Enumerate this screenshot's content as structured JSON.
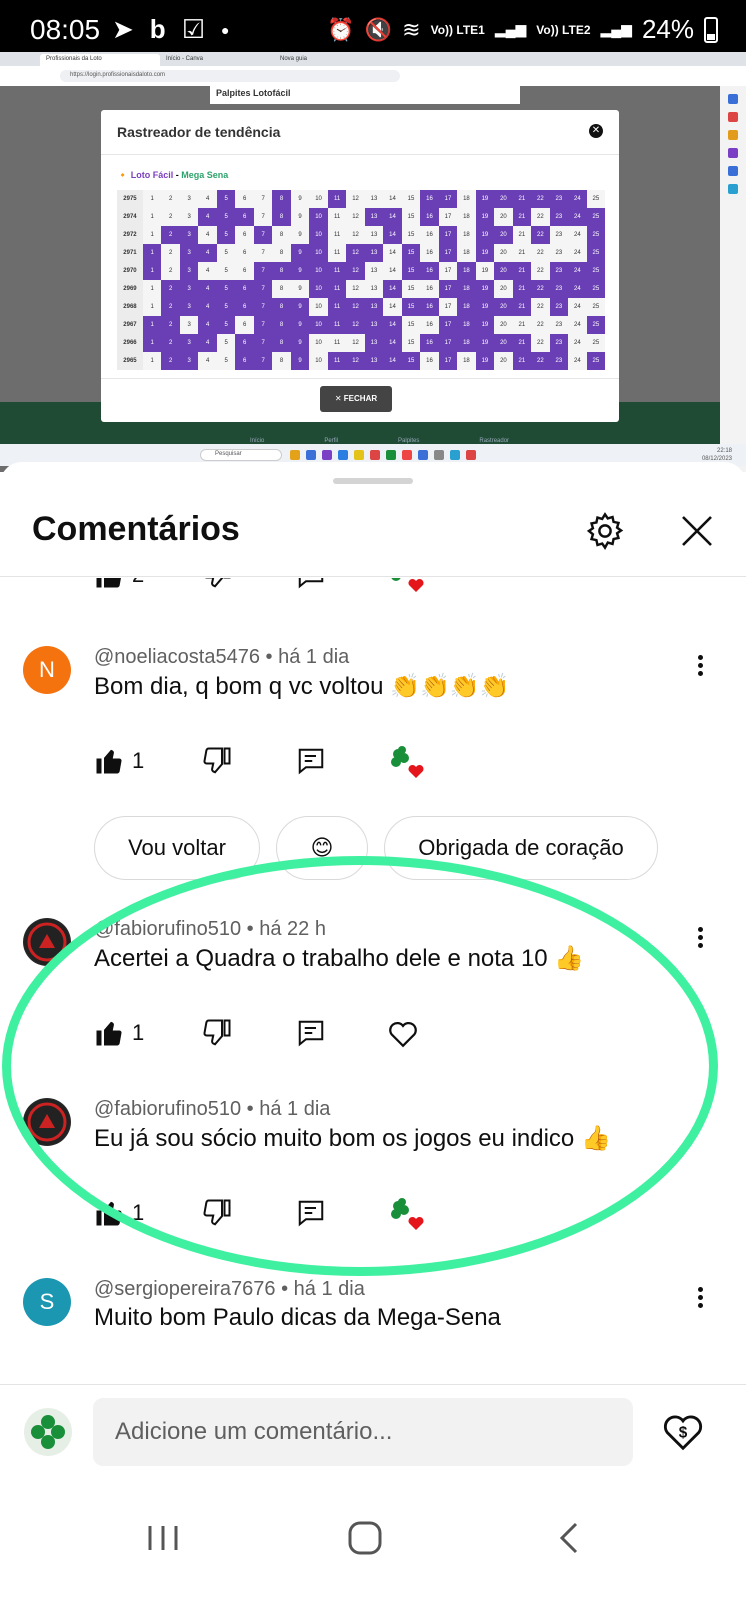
{
  "status_bar": {
    "time": "08:05",
    "battery_percent": "24%",
    "net1": "Vo)) LTE1",
    "net2": "Vo)) LTE2",
    "app_icons": [
      "telegram-icon",
      "b-icon",
      "checkbox-icon",
      "dot-icon"
    ]
  },
  "video": {
    "browser_tabs": [
      "Profissionais da Loto",
      "Início - Canva",
      "Nova guia"
    ],
    "url": "https://login.profissionaisdaloto.com",
    "page_heading": "Palpites Lotofácil",
    "modal": {
      "title": "Rastreador de tendência",
      "lotofacil_label": "Loto Fácil",
      "separator": "-",
      "megasena_label": "Mega Sena",
      "close_button": "FECHAR",
      "numbers": [
        "1",
        "2",
        "3",
        "4",
        "5",
        "6",
        "7",
        "8",
        "9",
        "10",
        "11",
        "12",
        "13",
        "14",
        "15",
        "16",
        "17",
        "18",
        "19",
        "20",
        "21",
        "22",
        "23",
        "24",
        "25"
      ],
      "rows": [
        {
          "contest": "2975",
          "marks": "0000100100100001101111110"
        },
        {
          "contest": "2974",
          "marks": "0001110101001101001010111"
        },
        {
          "contest": "2972",
          "marks": "0110101001000100101101001"
        },
        {
          "contest": "2971",
          "marks": "1011000011011010101000001"
        },
        {
          "contest": "2970",
          "marks": "1010001111110011010110111"
        },
        {
          "contest": "2969",
          "marks": "0111111001100100111011111"
        },
        {
          "contest": "2968",
          "marks": "0111111110111011011110100"
        },
        {
          "contest": "2967",
          "marks": "1101101111111100111000001"
        },
        {
          "contest": "2966",
          "marks": "1111011110001101111110100"
        },
        {
          "contest": "2965",
          "marks": "0110011010111110101011101"
        }
      ]
    },
    "bottom_nav": [
      "Início",
      "Perfil",
      "Palpites",
      "Rastreador"
    ],
    "taskbar_search": "Pesquisar",
    "taskbar_time": "22:18",
    "taskbar_date": "08/12/2023"
  },
  "sheet": {
    "title": "Comentários",
    "partial_like_count": "2",
    "comments": [
      {
        "avatar_letter": "N",
        "author": "@noeliacosta5476",
        "time": "há 1 dia",
        "text": "Bom dia, q bom q vc voltou 👏👏👏👏",
        "likes": "1",
        "creator_heart": true
      },
      {
        "avatar_letter": "",
        "author": "@fabiorufino510",
        "time": "há 22 h",
        "text": "Acertei a Quadra o trabalho dele e nota 10 👍",
        "likes": "1",
        "creator_heart": false
      },
      {
        "avatar_letter": "",
        "author": "@fabiorufino510",
        "time": "há 1 dia",
        "text": "Eu já sou sócio muito bom os jogos eu indico 👍",
        "likes": "1",
        "creator_heart": true
      },
      {
        "avatar_letter": "S",
        "author": "@sergiopereira7676",
        "time": "há 1 dia",
        "text": "Muito bom Paulo dicas da Mega-Sena",
        "likes": "",
        "creator_heart": true
      }
    ],
    "meta_separator": "•",
    "reply_chips": [
      "Vou voltar",
      "😊",
      "Obrigada de coração"
    ],
    "composer_placeholder": "Adicione um comentário...",
    "highlight_color": "#3ff0a0"
  },
  "colors": {
    "lotofacil_purple": "#6a3fb5",
    "avatar_n": "#f4730f",
    "avatar_s": "#1b97b1",
    "clover_green": "#1a8f3a",
    "heart_red": "#e4161b"
  }
}
